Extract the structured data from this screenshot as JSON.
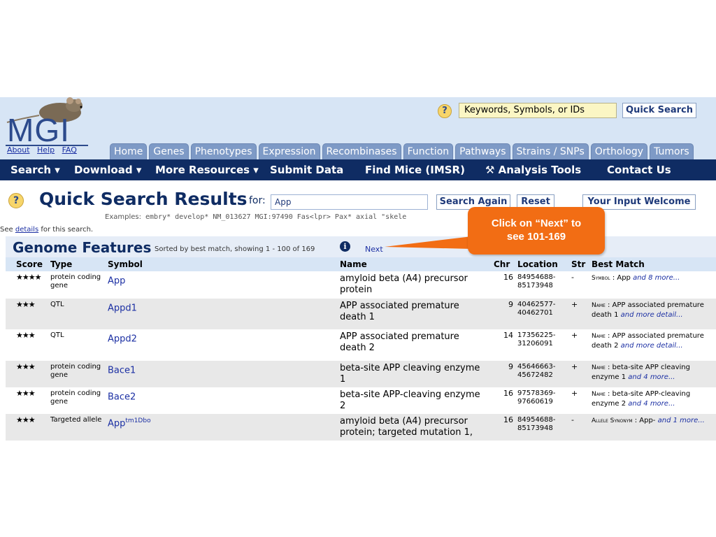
{
  "header": {
    "logo": "MGI",
    "links": [
      "About",
      "Help",
      "FAQ"
    ],
    "quick_search_placeholder": "Keywords, Symbols, or IDs",
    "quick_search_button": "Quick Search",
    "help_glyph": "?"
  },
  "tabs": [
    "Home",
    "Genes",
    "Phenotypes",
    "Expression",
    "Recombinases",
    "Function",
    "Pathways",
    "Strains / SNPs",
    "Orthology",
    "Tumors"
  ],
  "nav": {
    "search": "Search ▾",
    "download": "Download ▾",
    "more": "More Resources ▾",
    "submit": "Submit Data",
    "find_mice": "Find Mice (IMSR)",
    "analysis": "Analysis Tools",
    "contact": "Contact Us"
  },
  "results": {
    "title": "Quick Search Results",
    "for_label": "for:",
    "query": "App",
    "search_again": "Search Again",
    "reset": "Reset",
    "your_input": "Your Input Welcome",
    "examples_label": "Examples:",
    "examples": "embry* develop*   NM_013627   MGI:97490   Fas<lpr>   Pax*   axial \"skele",
    "details_pre": "See ",
    "details_link": "details",
    "details_post": " for this search."
  },
  "genome_features": {
    "title": "Genome Features",
    "sort_text": "Sorted by best match, showing 1 - 100 of 169",
    "info_glyph": "i",
    "next": "Next"
  },
  "columns": [
    "Score",
    "Type",
    "Symbol",
    "Name",
    "Chr",
    "Location",
    "Str",
    "Best Match"
  ],
  "rows": [
    {
      "score": "★★★★",
      "type": "protein coding gene",
      "symbol": "App",
      "sup": "",
      "name": "amyloid beta (A4) precursor protein",
      "chr": "16",
      "location": "84954688-85173948",
      "str": "-",
      "bm_label": "Symbol",
      "bm_text": " : App ",
      "bm_more": "and 8 more..."
    },
    {
      "score": "★★★",
      "type": "QTL",
      "symbol": "Appd1",
      "sup": "",
      "name": "APP associated premature death 1",
      "chr": "9",
      "location": "40462577-40462701",
      "str": "+",
      "bm_label": "Name",
      "bm_text": " : APP associated premature death 1 ",
      "bm_more": "and more detail..."
    },
    {
      "score": "★★★",
      "type": "QTL",
      "symbol": "Appd2",
      "sup": "",
      "name": "APP associated premature death 2",
      "chr": "14",
      "location": "17356225-31206091",
      "str": "+",
      "bm_label": "Name",
      "bm_text": " : APP associated premature death 2 ",
      "bm_more": "and more detail..."
    },
    {
      "score": "★★★",
      "type": "protein coding gene",
      "symbol": "Bace1",
      "sup": "",
      "name": "beta-site APP cleaving enzyme 1",
      "chr": "9",
      "location": "45646663-45672482",
      "str": "+",
      "bm_label": "Name",
      "bm_text": " : beta-site APP cleaving enzyme 1 ",
      "bm_more": "and 4 more..."
    },
    {
      "score": "★★★",
      "type": "protein coding gene",
      "symbol": "Bace2",
      "sup": "",
      "name": "beta-site APP-cleaving enzyme 2",
      "chr": "16",
      "location": "97578369-97660619",
      "str": "+",
      "bm_label": "Name",
      "bm_text": " : beta-site APP-cleaving enzyme 2 ",
      "bm_more": "and 4 more..."
    },
    {
      "score": "★★★",
      "type": "Targeted allele",
      "symbol": "App",
      "sup": "tm1Dbo",
      "name": "amyloid beta (A4) precursor protein; targeted mutation 1,",
      "chr": "16",
      "location": "84954688-85173948",
      "str": "-",
      "bm_label": "Allele Synonym",
      "bm_text": " : App- ",
      "bm_more": "and 1 more..."
    }
  ],
  "callout": {
    "line1": "Click on “Next” to",
    "line2": "see 101-169"
  },
  "colors": {
    "nav_bg": "#0f2c63",
    "tab_bg": "#7e9ac6",
    "header_bg": "#d7e5f5",
    "link": "#1b2fa3",
    "callout": "#f26d14"
  }
}
